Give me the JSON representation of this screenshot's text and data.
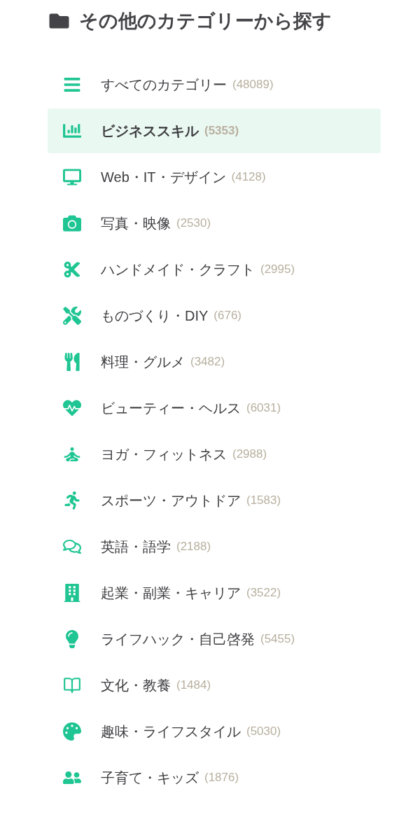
{
  "heading": {
    "title": "その他のカテゴリーから探す"
  },
  "categories": [
    {
      "label": "すべてのカテゴリー",
      "count": "(48089)",
      "selected": false
    },
    {
      "label": "ビジネススキル",
      "count": "(5353)",
      "selected": true
    },
    {
      "label": "Web・IT・デザイン",
      "count": "(4128)",
      "selected": false
    },
    {
      "label": "写真・映像",
      "count": "(2530)",
      "selected": false
    },
    {
      "label": "ハンドメイド・クラフト",
      "count": "(2995)",
      "selected": false
    },
    {
      "label": "ものづくり・DIY",
      "count": "(676)",
      "selected": false
    },
    {
      "label": "料理・グルメ",
      "count": "(3482)",
      "selected": false
    },
    {
      "label": "ビューティー・ヘルス",
      "count": "(6031)",
      "selected": false
    },
    {
      "label": "ヨガ・フィットネス",
      "count": "(2988)",
      "selected": false
    },
    {
      "label": "スポーツ・アウトドア",
      "count": "(1583)",
      "selected": false
    },
    {
      "label": "英語・語学",
      "count": "(2188)",
      "selected": false
    },
    {
      "label": "起業・副業・キャリア",
      "count": "(3522)",
      "selected": false
    },
    {
      "label": "ライフハック・自己啓発",
      "count": "(5455)",
      "selected": false
    },
    {
      "label": "文化・教養",
      "count": "(1484)",
      "selected": false
    },
    {
      "label": "趣味・ライフスタイル",
      "count": "(5030)",
      "selected": false
    },
    {
      "label": "子育て・キッズ",
      "count": "(1876)",
      "selected": false
    }
  ]
}
